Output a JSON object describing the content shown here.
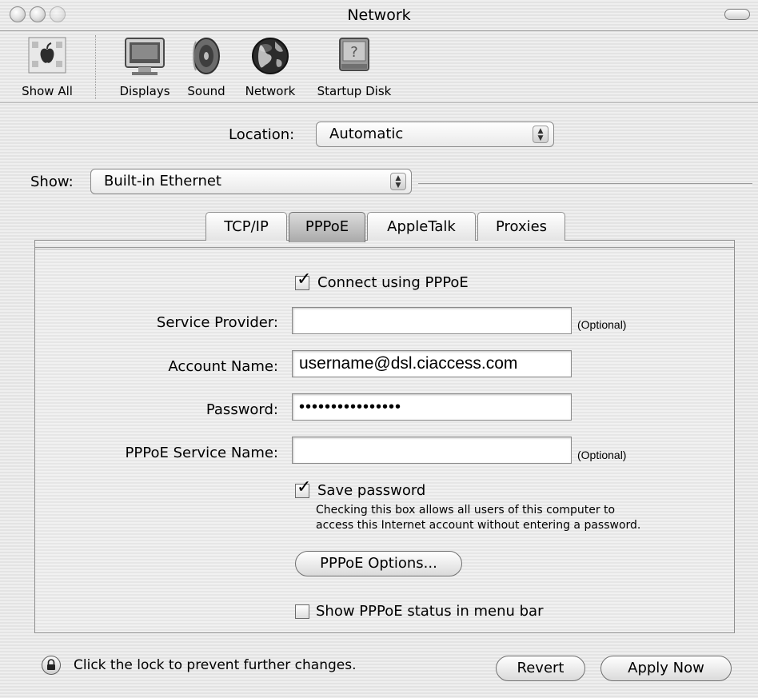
{
  "window": {
    "title": "Network"
  },
  "toolbar": {
    "items": [
      {
        "label": "Show All",
        "icon": "apple-icon"
      },
      {
        "label": "Displays",
        "icon": "display-icon"
      },
      {
        "label": "Sound",
        "icon": "speaker-icon"
      },
      {
        "label": "Network",
        "icon": "globe-icon"
      },
      {
        "label": "Startup Disk",
        "icon": "disk-icon"
      }
    ]
  },
  "location": {
    "label": "Location:",
    "value": "Automatic"
  },
  "show": {
    "label": "Show:",
    "value": "Built-in Ethernet"
  },
  "tabs": [
    {
      "label": "TCP/IP"
    },
    {
      "label": "PPPoE",
      "active": true
    },
    {
      "label": "AppleTalk"
    },
    {
      "label": "Proxies"
    }
  ],
  "pppoe": {
    "connect_label": "Connect using PPPoE",
    "connect_checked": true,
    "service_provider": {
      "label": "Service Provider:",
      "value": "",
      "hint": "(Optional)"
    },
    "account_name": {
      "label": "Account Name:",
      "value": "username@dsl.ciaccess.com"
    },
    "password": {
      "label": "Password:",
      "value": "••••••••••••••••"
    },
    "service_name": {
      "label": "PPPoE Service Name:",
      "value": "",
      "hint": "(Optional)"
    },
    "save_password_label": "Save password",
    "save_password_checked": true,
    "save_password_note_line1": "Checking this box allows all users of this computer to",
    "save_password_note_line2": "access this Internet account without entering a password.",
    "options_button": "PPPoE Options...",
    "status_label": "Show PPPoE status in menu bar",
    "status_checked": false
  },
  "footer": {
    "lock_text": "Click the lock to prevent further changes.",
    "revert_button": "Revert",
    "apply_button": "Apply Now"
  }
}
